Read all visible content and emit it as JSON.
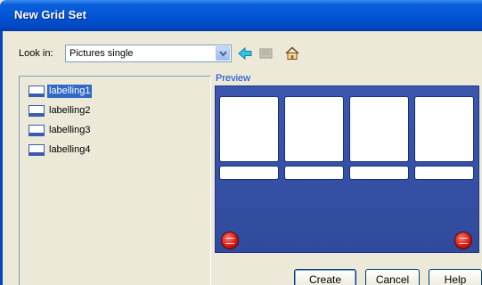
{
  "window": {
    "title": "New Grid Set"
  },
  "lookin": {
    "label": "Look in:",
    "value": "Pictures single"
  },
  "toolbar": {
    "back_icon": "back-arrow-icon",
    "folder_icon": "folder-up-icon",
    "home_icon": "home-icon"
  },
  "tree": {
    "items": [
      {
        "label": "labelling1",
        "selected": true
      },
      {
        "label": "labelling2",
        "selected": false
      },
      {
        "label": "labelling3",
        "selected": false
      },
      {
        "label": "labelling4",
        "selected": false
      }
    ]
  },
  "preview": {
    "label": "Preview",
    "columns": 4,
    "background": "#3b57b0",
    "accent": "#d3140c"
  },
  "buttons": {
    "create": "Create",
    "cancel": "Cancel",
    "help": "Help"
  },
  "colors": {
    "title_bar": "#0255d6",
    "selection": "#316ac5",
    "dialog_bg": "#ece9d8"
  }
}
